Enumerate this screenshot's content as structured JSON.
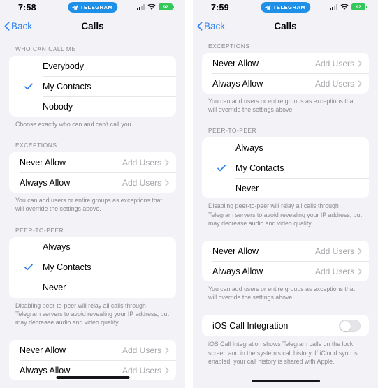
{
  "statusbar": {
    "time_left": "7:58",
    "time_right": "7:59",
    "app_badge": "TELEGRAM",
    "battery_level": "92",
    "icons": [
      "cellular-signal-icon",
      "wifi-icon",
      "battery-icon"
    ]
  },
  "nav": {
    "back_label": "Back",
    "title": "Calls"
  },
  "colors": {
    "accent": "#2D7FF0",
    "background": "#F2F2F7",
    "card": "#FFFFFF",
    "badge_blue": "#1E90E8",
    "battery_green": "#34C759",
    "secondary_text": "#8A8A8E",
    "value_text": "#A8A8AD"
  },
  "sections": {
    "who_can_call_me": {
      "header": "WHO CAN CALL ME",
      "options": [
        {
          "label": "Everybody",
          "selected": false
        },
        {
          "label": "My Contacts",
          "selected": true
        },
        {
          "label": "Nobody",
          "selected": false
        }
      ],
      "footnote": "Choose exactly who can and can't call you."
    },
    "exceptions": {
      "header": "EXCEPTIONS",
      "rows": [
        {
          "label": "Never Allow",
          "value": "Add Users"
        },
        {
          "label": "Always Allow",
          "value": "Add Users"
        }
      ],
      "footnote": "You can add users or entire groups as exceptions that will override the settings above."
    },
    "peer_to_peer": {
      "header": "PEER-TO-PEER",
      "options": [
        {
          "label": "Always",
          "selected": false
        },
        {
          "label": "My Contacts",
          "selected": true
        },
        {
          "label": "Never",
          "selected": false
        }
      ],
      "footnote": "Disabling peer-to-peer will relay all calls through Telegram servers to avoid revealing your IP address, but may decrease audio and video quality."
    },
    "exceptions2": {
      "rows": [
        {
          "label": "Never Allow",
          "value": "Add Users"
        },
        {
          "label": "Always Allow",
          "value": "Add Users"
        }
      ],
      "footnote": "You can add users or entire groups as exceptions that will override the settings above."
    },
    "ios_call_integration": {
      "label": "iOS Call Integration",
      "enabled": false,
      "footnote": "iOS Call Integration shows Telegram calls on the lock screen and in the system's call history. If iCloud sync is enabled, your call history is shared with Apple."
    }
  }
}
